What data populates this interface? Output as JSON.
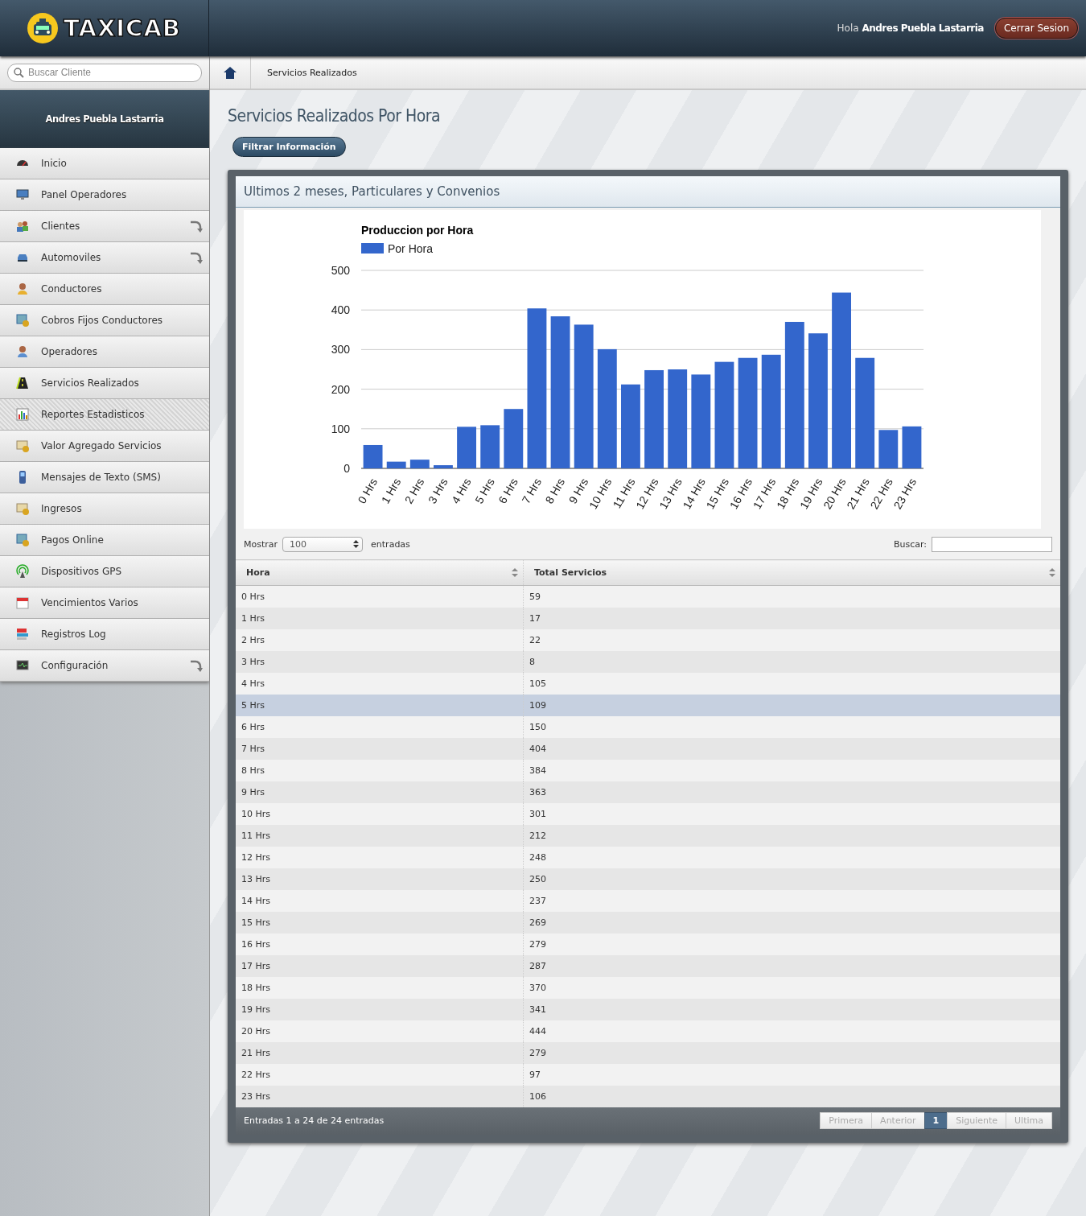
{
  "header": {
    "logo": "TAXICAB",
    "greeting": "Hola",
    "user": "Andres Puebla Lastarria",
    "logout": "Cerrar Sesion"
  },
  "sidebar": {
    "search": {
      "placeholder": "Buscar Cliente"
    },
    "user": "Andres Puebla Lastarria",
    "items": [
      {
        "label": "Inicio",
        "selected": false,
        "submenu": false
      },
      {
        "label": "Panel Operadores",
        "selected": false,
        "submenu": false
      },
      {
        "label": "Clientes",
        "selected": false,
        "submenu": true
      },
      {
        "label": "Automoviles",
        "selected": false,
        "submenu": true
      },
      {
        "label": "Conductores",
        "selected": false,
        "submenu": false
      },
      {
        "label": "Cobros Fijos Conductores",
        "selected": false,
        "submenu": false
      },
      {
        "label": "Operadores",
        "selected": false,
        "submenu": false
      },
      {
        "label": "Servicios Realizados",
        "selected": false,
        "submenu": false
      },
      {
        "label": "Reportes Estadisticos",
        "selected": true,
        "submenu": false
      },
      {
        "label": "Valor Agregado Servicios",
        "selected": false,
        "submenu": false
      },
      {
        "label": "Mensajes de Texto (SMS)",
        "selected": false,
        "submenu": false
      },
      {
        "label": "Ingresos",
        "selected": false,
        "submenu": false
      },
      {
        "label": "Pagos Online",
        "selected": false,
        "submenu": false
      },
      {
        "label": "Dispositivos GPS",
        "selected": false,
        "submenu": false
      },
      {
        "label": "Vencimientos Varios",
        "selected": false,
        "submenu": false
      },
      {
        "label": "Registros Log",
        "selected": false,
        "submenu": false
      },
      {
        "label": "Configuración",
        "selected": false,
        "submenu": true
      }
    ]
  },
  "breadcrumb": [
    "Servicios Realizados"
  ],
  "page_title": "Servicios Realizados Por Hora",
  "filter_button": "Filtrar Información",
  "panel": {
    "title": "Ultimos 2 meses, Particulares y Convenios",
    "chart_data": {
      "type": "bar",
      "title": "Produccion por Hora",
      "categories": [
        "0 Hrs",
        "1 Hrs",
        "2 Hrs",
        "3 Hrs",
        "4 Hrs",
        "5 Hrs",
        "6 Hrs",
        "7 Hrs",
        "8 Hrs",
        "9 Hrs",
        "10 Hrs",
        "11 Hrs",
        "12 Hrs",
        "13 Hrs",
        "14 Hrs",
        "15 Hrs",
        "16 Hrs",
        "17 Hrs",
        "18 Hrs",
        "19 Hrs",
        "20 Hrs",
        "21 Hrs",
        "22 Hrs",
        "23 Hrs"
      ],
      "series": [
        {
          "name": "Por Hora",
          "color": "#3366cc",
          "values": [
            59,
            17,
            22,
            8,
            105,
            109,
            150,
            404,
            384,
            363,
            301,
            212,
            248,
            250,
            237,
            269,
            279,
            287,
            370,
            341,
            444,
            279,
            97,
            106
          ]
        }
      ],
      "grid": true,
      "ylim": [
        0,
        500
      ],
      "yticks": [
        0,
        100,
        200,
        300,
        400,
        500
      ]
    },
    "length": {
      "label_before": "Mostrar",
      "value": "100",
      "label_after": "entradas"
    },
    "search": {
      "label": "Buscar:"
    },
    "table": {
      "columns": [
        "Hora",
        "Total Servicios"
      ],
      "rows": [
        {
          "cells": [
            "0 Hrs",
            "59"
          ],
          "selected": false
        },
        {
          "cells": [
            "1 Hrs",
            "17"
          ],
          "selected": false
        },
        {
          "cells": [
            "2 Hrs",
            "22"
          ],
          "selected": false
        },
        {
          "cells": [
            "3 Hrs",
            "8"
          ],
          "selected": false
        },
        {
          "cells": [
            "4 Hrs",
            "105"
          ],
          "selected": false
        },
        {
          "cells": [
            "5 Hrs",
            "109"
          ],
          "selected": true
        },
        {
          "cells": [
            "6 Hrs",
            "150"
          ],
          "selected": false
        },
        {
          "cells": [
            "7 Hrs",
            "404"
          ],
          "selected": false
        },
        {
          "cells": [
            "8 Hrs",
            "384"
          ],
          "selected": false
        },
        {
          "cells": [
            "9 Hrs",
            "363"
          ],
          "selected": false
        },
        {
          "cells": [
            "10 Hrs",
            "301"
          ],
          "selected": false
        },
        {
          "cells": [
            "11 Hrs",
            "212"
          ],
          "selected": false
        },
        {
          "cells": [
            "12 Hrs",
            "248"
          ],
          "selected": false
        },
        {
          "cells": [
            "13 Hrs",
            "250"
          ],
          "selected": false
        },
        {
          "cells": [
            "14 Hrs",
            "237"
          ],
          "selected": false
        },
        {
          "cells": [
            "15 Hrs",
            "269"
          ],
          "selected": false
        },
        {
          "cells": [
            "16 Hrs",
            "279"
          ],
          "selected": false
        },
        {
          "cells": [
            "17 Hrs",
            "287"
          ],
          "selected": false
        },
        {
          "cells": [
            "18 Hrs",
            "370"
          ],
          "selected": false
        },
        {
          "cells": [
            "19 Hrs",
            "341"
          ],
          "selected": false
        },
        {
          "cells": [
            "20 Hrs",
            "444"
          ],
          "selected": false
        },
        {
          "cells": [
            "21 Hrs",
            "279"
          ],
          "selected": false
        },
        {
          "cells": [
            "22 Hrs",
            "97"
          ],
          "selected": false
        },
        {
          "cells": [
            "23 Hrs",
            "106"
          ],
          "selected": false
        }
      ]
    },
    "info": "Entradas 1 a 24 de 24 entradas",
    "pagination": [
      {
        "label": "Primera",
        "selected": false,
        "disabled": true
      },
      {
        "label": "Anterior",
        "selected": false,
        "disabled": true
      },
      {
        "label": "1",
        "selected": true,
        "disabled": false
      },
      {
        "label": "Siguiente",
        "selected": false,
        "disabled": true
      },
      {
        "label": "Ultima",
        "selected": false,
        "disabled": true
      }
    ]
  }
}
